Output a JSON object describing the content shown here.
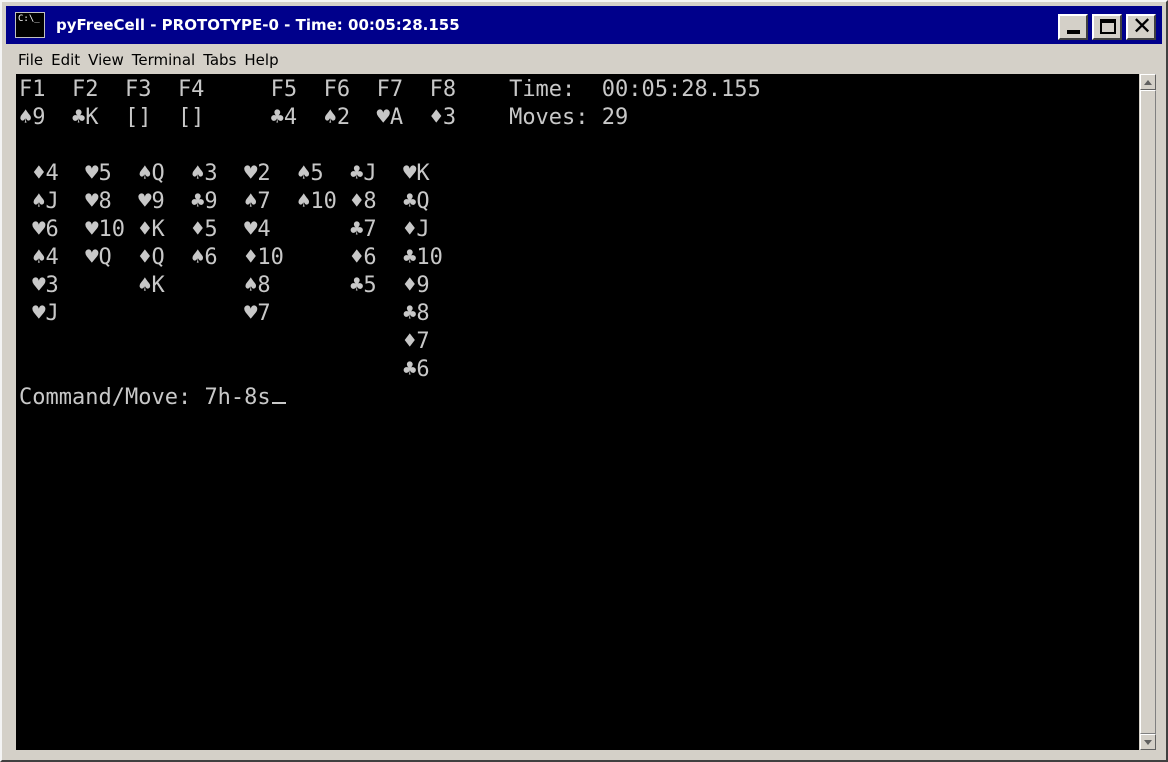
{
  "window": {
    "title": "pyFreeCell - PROTOTYPE-0 - Time: 00:05:28.155",
    "icon": "terminal-icon",
    "icon_text": "C:\\_"
  },
  "menu": [
    "File",
    "Edit",
    "View",
    "Terminal",
    "Tabs",
    "Help"
  ],
  "terminal": {
    "lines": [
      "F1  F2  F3  F4     F5  F6  F7  F8    Time:  00:05:28.155",
      "♠9  ♣K  []  []     ♣4  ♠2  ♥A  ♦3    Moves: 29",
      "",
      " ♦4  ♥5  ♠Q  ♠3  ♥2  ♠5  ♣J  ♥K",
      " ♠J  ♥8  ♥9  ♣9  ♠7  ♠10 ♦8  ♣Q",
      " ♥6  ♥10 ♦K  ♦5  ♥4      ♣7  ♦J",
      " ♠4  ♥Q  ♦Q  ♠6  ♦10     ♦6  ♣10",
      " ♥3      ♠K      ♠8      ♣5  ♦9",
      " ♥J              ♥7          ♣8",
      "                             ♦7",
      "                             ♣6"
    ],
    "prompt": "Command/Move: ",
    "input": "7h-8s"
  },
  "colors": {
    "titlebar": "#00008b",
    "terminal_bg": "#000000",
    "terminal_fg": "#c8c8c8"
  }
}
